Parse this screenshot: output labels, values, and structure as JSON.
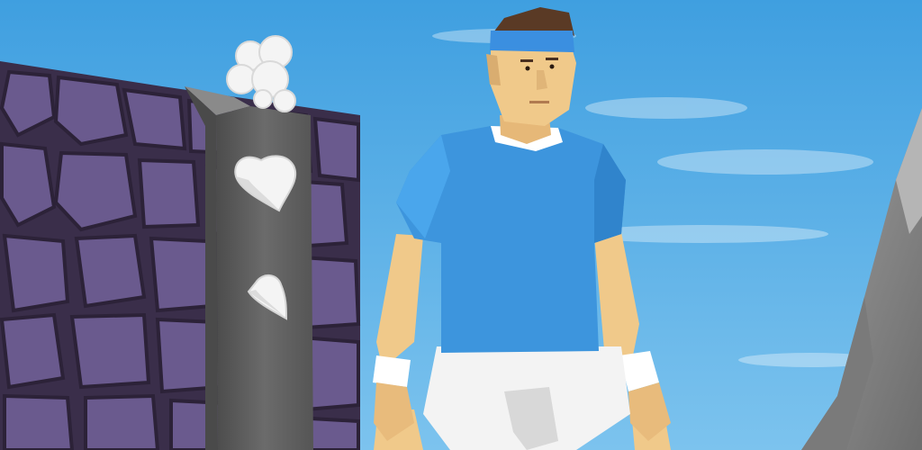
{
  "scene": {
    "description_free": true,
    "colors": {
      "sky_top": "#3f9fe0",
      "sky_bottom": "#79c3ee",
      "stone": "#6a5a8e",
      "stone_dark": "#3a2e4a",
      "pillar": "#5f5f5f",
      "shirt": "#3d95dd",
      "skin": "#f0c98a",
      "headband": "#3b8fe0",
      "shorts": "#f2f2f2",
      "rock": "#8d8d8d"
    }
  }
}
